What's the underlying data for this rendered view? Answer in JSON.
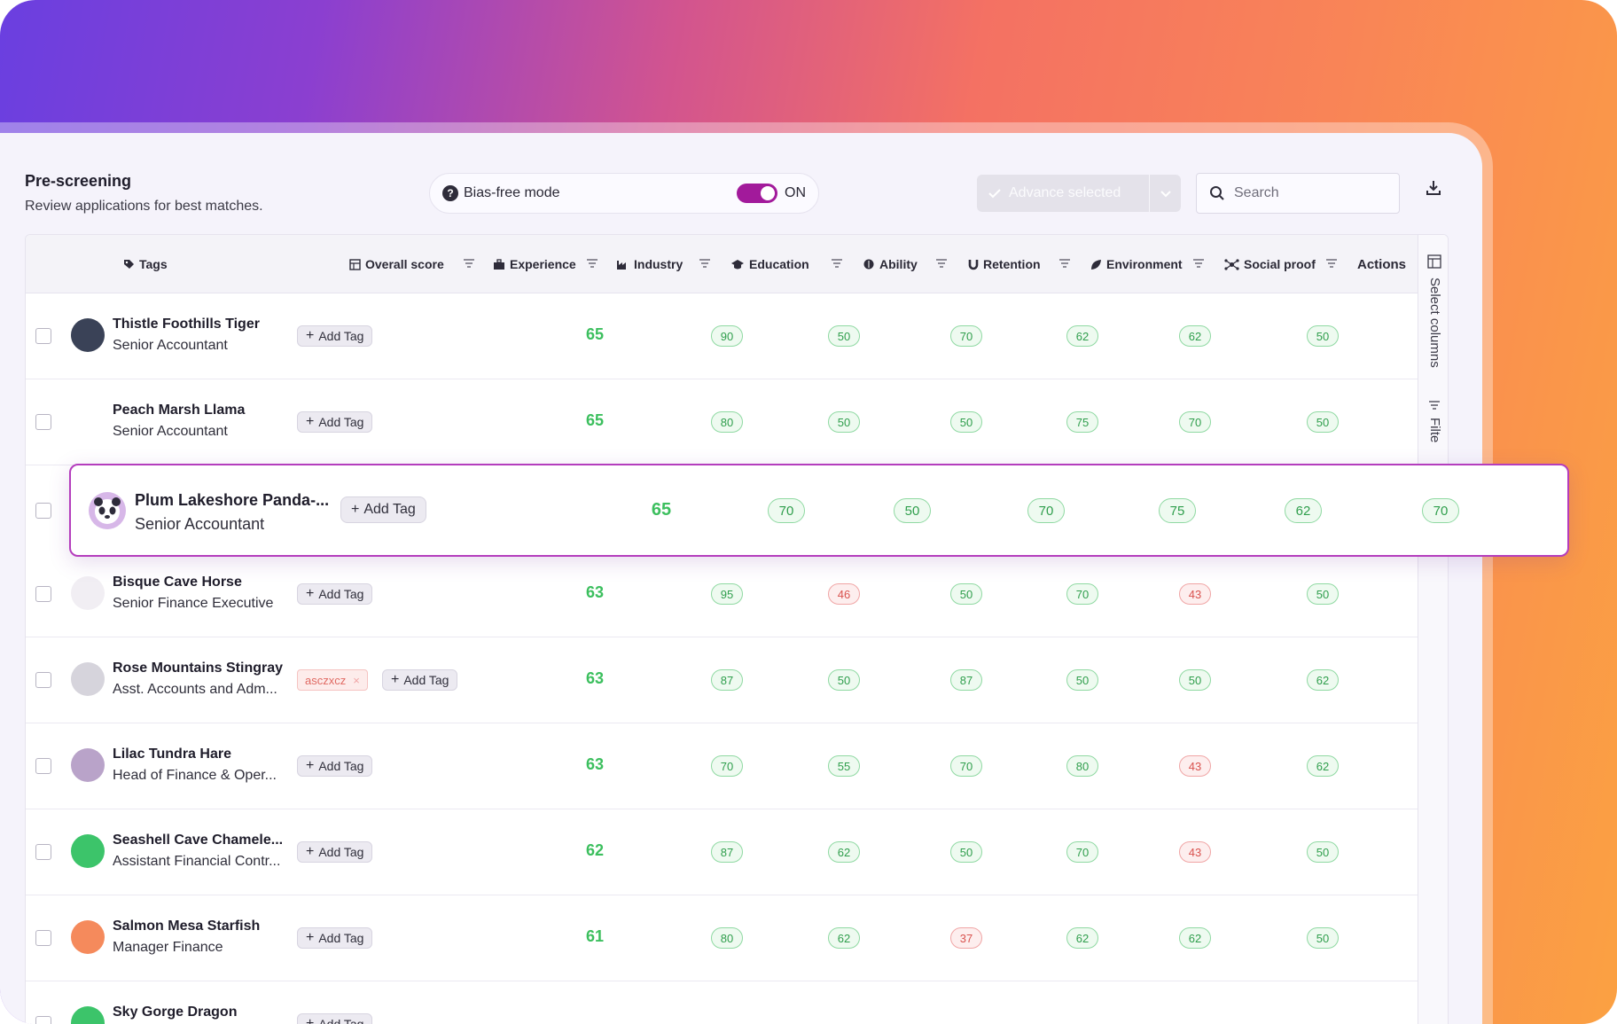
{
  "header": {
    "title": "Pre-screening",
    "subtitle": "Review applications for best matches."
  },
  "bias": {
    "label": "Bias-free mode",
    "state": "ON"
  },
  "toolbar": {
    "advance_label": "Advance selected",
    "search_placeholder": "Search"
  },
  "side_panel": {
    "select_columns": "Select columns",
    "filters": "Filte"
  },
  "columns": {
    "tags": "Tags",
    "overall": "Overall score",
    "experience": "Experience",
    "industry": "Industry",
    "education": "Education",
    "ability": "Ability",
    "retention": "Retention",
    "environment": "Environment",
    "social": "Social proof",
    "actions": "Actions"
  },
  "add_tag_label": "Add Tag",
  "colors": {
    "accent": "#a21a9b",
    "score_green": "#3cbf5e",
    "score_red": "#d9534f"
  },
  "rows": [
    {
      "name": "Thistle Foothills Tiger",
      "role": "Senior Accountant",
      "overall": "65",
      "scores": [
        "90",
        "50",
        "70",
        "62",
        "62",
        "50"
      ],
      "low": [
        false,
        false,
        false,
        false,
        false,
        false
      ],
      "avatar": "#3a4257"
    },
    {
      "name": "Peach Marsh Llama",
      "role": "Senior Accountant",
      "overall": "65",
      "scores": [
        "80",
        "50",
        "50",
        "75",
        "70",
        "50"
      ],
      "low": [
        false,
        false,
        false,
        false,
        false,
        false
      ],
      "avatar": "#ffffff"
    },
    {
      "name": "Plum Lakeshore Panda-...",
      "role": "Senior Accountant",
      "overall": "65",
      "scores": [
        "70",
        "50",
        "70",
        "75",
        "62",
        "70"
      ],
      "low": [
        false,
        false,
        false,
        false,
        false,
        false
      ],
      "avatar": "#d7b7e8"
    },
    {
      "name": "Bisque Cave Horse",
      "role": "Senior Finance Executive",
      "overall": "63",
      "scores": [
        "95",
        "46",
        "50",
        "70",
        "43",
        "50"
      ],
      "low": [
        false,
        true,
        false,
        false,
        true,
        false
      ],
      "avatar": "#f1eef3"
    },
    {
      "name": "Rose Mountains Stingray",
      "role": "Asst. Accounts and Adm...",
      "overall": "63",
      "tag": "asczxcz",
      "scores": [
        "87",
        "50",
        "87",
        "50",
        "50",
        "62"
      ],
      "low": [
        false,
        false,
        false,
        false,
        false,
        false
      ],
      "avatar": "#d6d4dc"
    },
    {
      "name": "Lilac Tundra Hare",
      "role": "Head of Finance & Oper...",
      "overall": "63",
      "scores": [
        "70",
        "55",
        "70",
        "80",
        "43",
        "62"
      ],
      "low": [
        false,
        false,
        false,
        false,
        true,
        false
      ],
      "avatar": "#b9a3c9"
    },
    {
      "name": "Seashell Cave Chamele...",
      "role": "Assistant Financial Contr...",
      "overall": "62",
      "scores": [
        "87",
        "62",
        "50",
        "70",
        "43",
        "50"
      ],
      "low": [
        false,
        false,
        false,
        false,
        true,
        false
      ],
      "avatar": "#3cc46a"
    },
    {
      "name": "Salmon Mesa Starfish",
      "role": "Manager Finance",
      "overall": "61",
      "scores": [
        "80",
        "62",
        "37",
        "62",
        "62",
        "50"
      ],
      "low": [
        false,
        false,
        true,
        false,
        false,
        false
      ],
      "avatar": "#f58a5c"
    },
    {
      "name": "Sky Gorge Dragon",
      "role": "",
      "overall": "",
      "scores": [
        "",
        "",
        "",
        "",
        "",
        ""
      ],
      "low": [
        false,
        false,
        false,
        false,
        false,
        false
      ],
      "avatar": "#3cc46a"
    }
  ]
}
